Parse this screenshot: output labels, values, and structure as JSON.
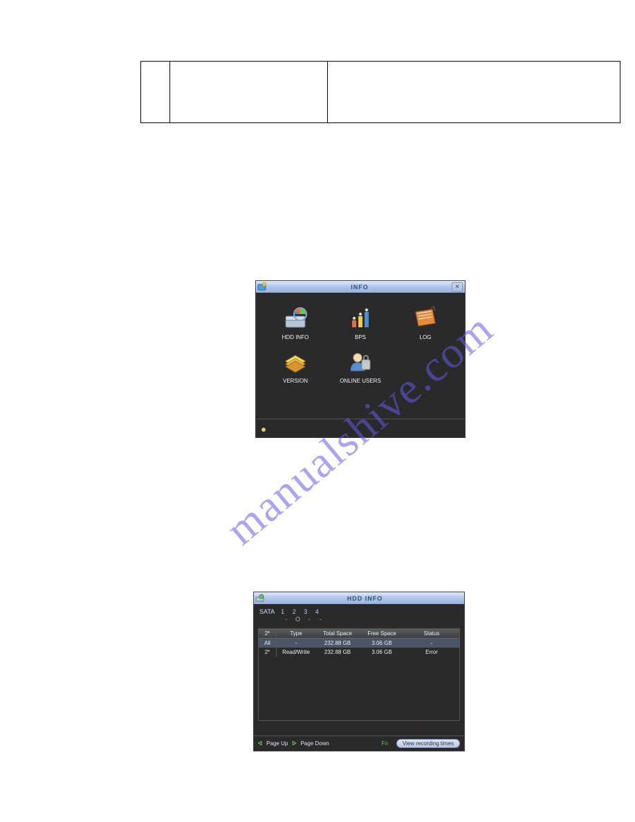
{
  "watermark": "manualshive.com",
  "info_window": {
    "title": "INFO",
    "items": [
      {
        "label": "HDD INFO",
        "icon": "hdd-info-icon"
      },
      {
        "label": "BPS",
        "icon": "bps-icon"
      },
      {
        "label": "LOG",
        "icon": "log-icon"
      },
      {
        "label": "VERSION",
        "icon": "version-icon"
      },
      {
        "label": "ONLINE USERS",
        "icon": "online-users-icon"
      }
    ]
  },
  "hdd_window": {
    "title": "HDD INFO",
    "sata_label": "SATA",
    "sata_ports": [
      "1",
      "2",
      "3",
      "4"
    ],
    "sata_status": [
      "-",
      "O",
      "-",
      "-"
    ],
    "columns": {
      "idx": "2*",
      "type": "Type",
      "total": "Total Space",
      "free": "Free Space",
      "status": "Status"
    },
    "rows": [
      {
        "idx": "All",
        "type": "-",
        "total": "232.88 GB",
        "free": "3.06 GB",
        "status": "-"
      },
      {
        "idx": "2*",
        "type": "Read/Write",
        "total": "232.88 GB",
        "free": "3.06 GB",
        "status": "Error"
      }
    ],
    "footer": {
      "page_up": "Page Up",
      "page_down": "Page Down",
      "fn": "Fn",
      "view_btn": "View recording times"
    }
  }
}
